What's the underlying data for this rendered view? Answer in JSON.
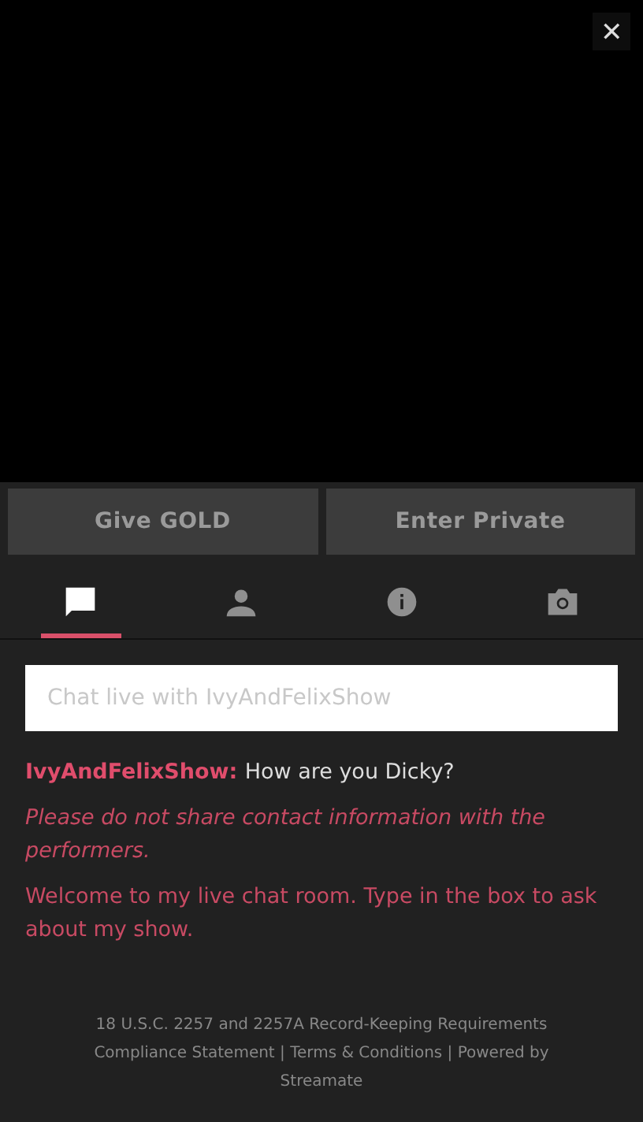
{
  "close_button": {
    "label": "✕"
  },
  "buttons": [
    "Give GOLD",
    "Enter Private"
  ],
  "tabs": [
    {
      "kind": "chat",
      "selected": true
    },
    {
      "kind": "person",
      "selected": false
    },
    {
      "kind": "info",
      "selected": false
    },
    {
      "kind": "camera",
      "selected": false
    }
  ],
  "chat_input": {
    "placeholder": "Chat live with IvyAndFelixShow"
  },
  "messages": [
    {
      "kind": "user",
      "author": "IvyAndFelixShow:",
      "text": "How are you Dicky?"
    },
    {
      "kind": "notice",
      "text": "Please do not share contact information with the performers."
    },
    {
      "kind": "welcome",
      "text": "Welcome to my live chat room. Type in the box to ask about my show."
    }
  ],
  "footer": "18 U.S.C. 2257 and 2257A Record-Keeping Requirements Compliance Statement | Terms & Conditions | Powered by Streamate"
}
